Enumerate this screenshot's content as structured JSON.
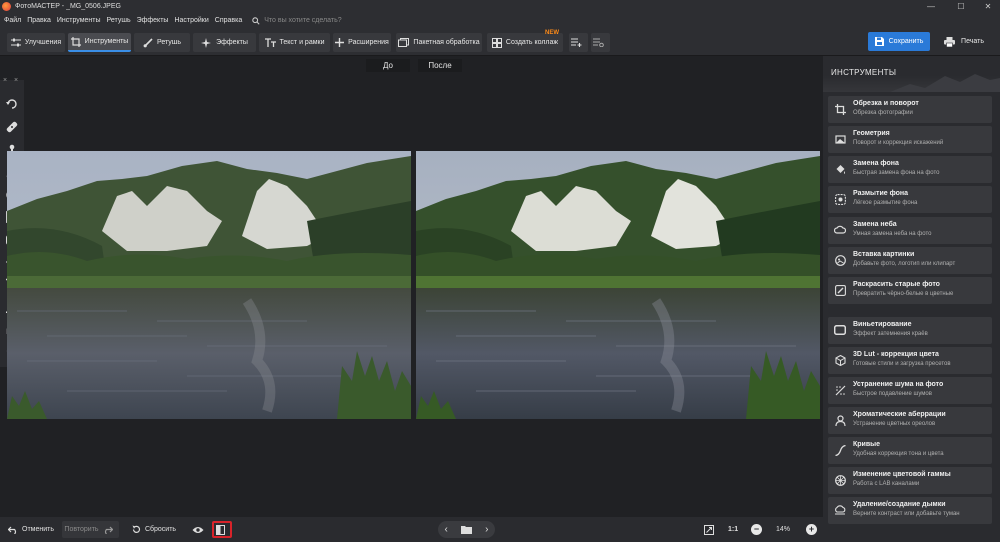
{
  "window": {
    "title": "ФотоМАСТЕР - _MG_0506.JPEG",
    "controls": [
      "—",
      "☐",
      "✕"
    ]
  },
  "menu": {
    "items": [
      "Файл",
      "Правка",
      "Инструменты",
      "Ретушь",
      "Эффекты",
      "Настройки",
      "Справка"
    ],
    "search_placeholder": "Что вы хотите сделать?"
  },
  "toolbar": {
    "tabs": [
      {
        "label": "Улучшения",
        "icon": "sliders-icon"
      },
      {
        "label": "Инструменты",
        "icon": "crop-icon",
        "active": true
      },
      {
        "label": "Ретушь",
        "icon": "brush-icon"
      },
      {
        "label": "Эффекты",
        "icon": "sparkle-icon"
      },
      {
        "label": "Текст и рамки",
        "icon": "text-icon"
      },
      {
        "label": "Расширения",
        "icon": "plus-icon"
      }
    ],
    "batch_label": "Пакетная обработка",
    "collage_label": "Создать коллаж",
    "collage_badge": "NEW",
    "save_label": "Сохранить",
    "print_label": "Печать"
  },
  "compare": {
    "before_label": "До",
    "after_label": "После"
  },
  "right_panel": {
    "title": "ИНСТРУМЕНТЫ",
    "tools": [
      {
        "title": "Обрезка и поворот",
        "subtitle": "Обрезка фотографии",
        "icon": "crop-icon"
      },
      {
        "title": "Геометрия",
        "subtitle": "Поворот и коррекция искажений",
        "icon": "geometry-icon"
      },
      {
        "title": "Замена фона",
        "subtitle": "Быстрая замена фона на фото",
        "icon": "fill-icon"
      },
      {
        "title": "Размытие фона",
        "subtitle": "Лёгкое размытие фона",
        "icon": "blur-icon"
      },
      {
        "title": "Замена неба",
        "subtitle": "Умная замена неба на фото",
        "icon": "sky-icon"
      },
      {
        "title": "Вставка картинки",
        "subtitle": "Добавьте фото, логотип или клипарт",
        "icon": "insert-image-icon"
      },
      {
        "title": "Раскрасить старые фото",
        "subtitle": "Превратить чёрно-белые в цветные",
        "icon": "colorize-icon"
      },
      {
        "title": "Виньетирование",
        "subtitle": "Эффект затемнения краёв",
        "icon": "vignette-icon"
      },
      {
        "title": "3D Lut - коррекция цвета",
        "subtitle": "Готовые стили и загрузка пресетов",
        "icon": "lut-icon"
      },
      {
        "title": "Устранение шума на фото",
        "subtitle": "Быстрое подавление шумов",
        "icon": "denoise-icon"
      },
      {
        "title": "Хроматические аберрации",
        "subtitle": "Устранение цветных ореолов",
        "icon": "aberration-icon"
      },
      {
        "title": "Кривые",
        "subtitle": "Удобная коррекция тона и цвета",
        "icon": "curves-icon"
      },
      {
        "title": "Изменение цветовой гаммы",
        "subtitle": "Работа с LAB каналами",
        "icon": "color-wheel-icon"
      },
      {
        "title": "Удаление/создание дымки",
        "subtitle": "Верните контраст или добавьте туман",
        "icon": "haze-icon"
      }
    ]
  },
  "bottom": {
    "undo_label": "Отменить",
    "redo_label": "Повторить",
    "reset_label": "Сбросить",
    "zoom_ratio": "1:1",
    "zoom_percent": "14%"
  },
  "colors": {
    "accent": "#2a7ad8",
    "highlight": "#d9232a",
    "badge": "#ff8c1a"
  }
}
